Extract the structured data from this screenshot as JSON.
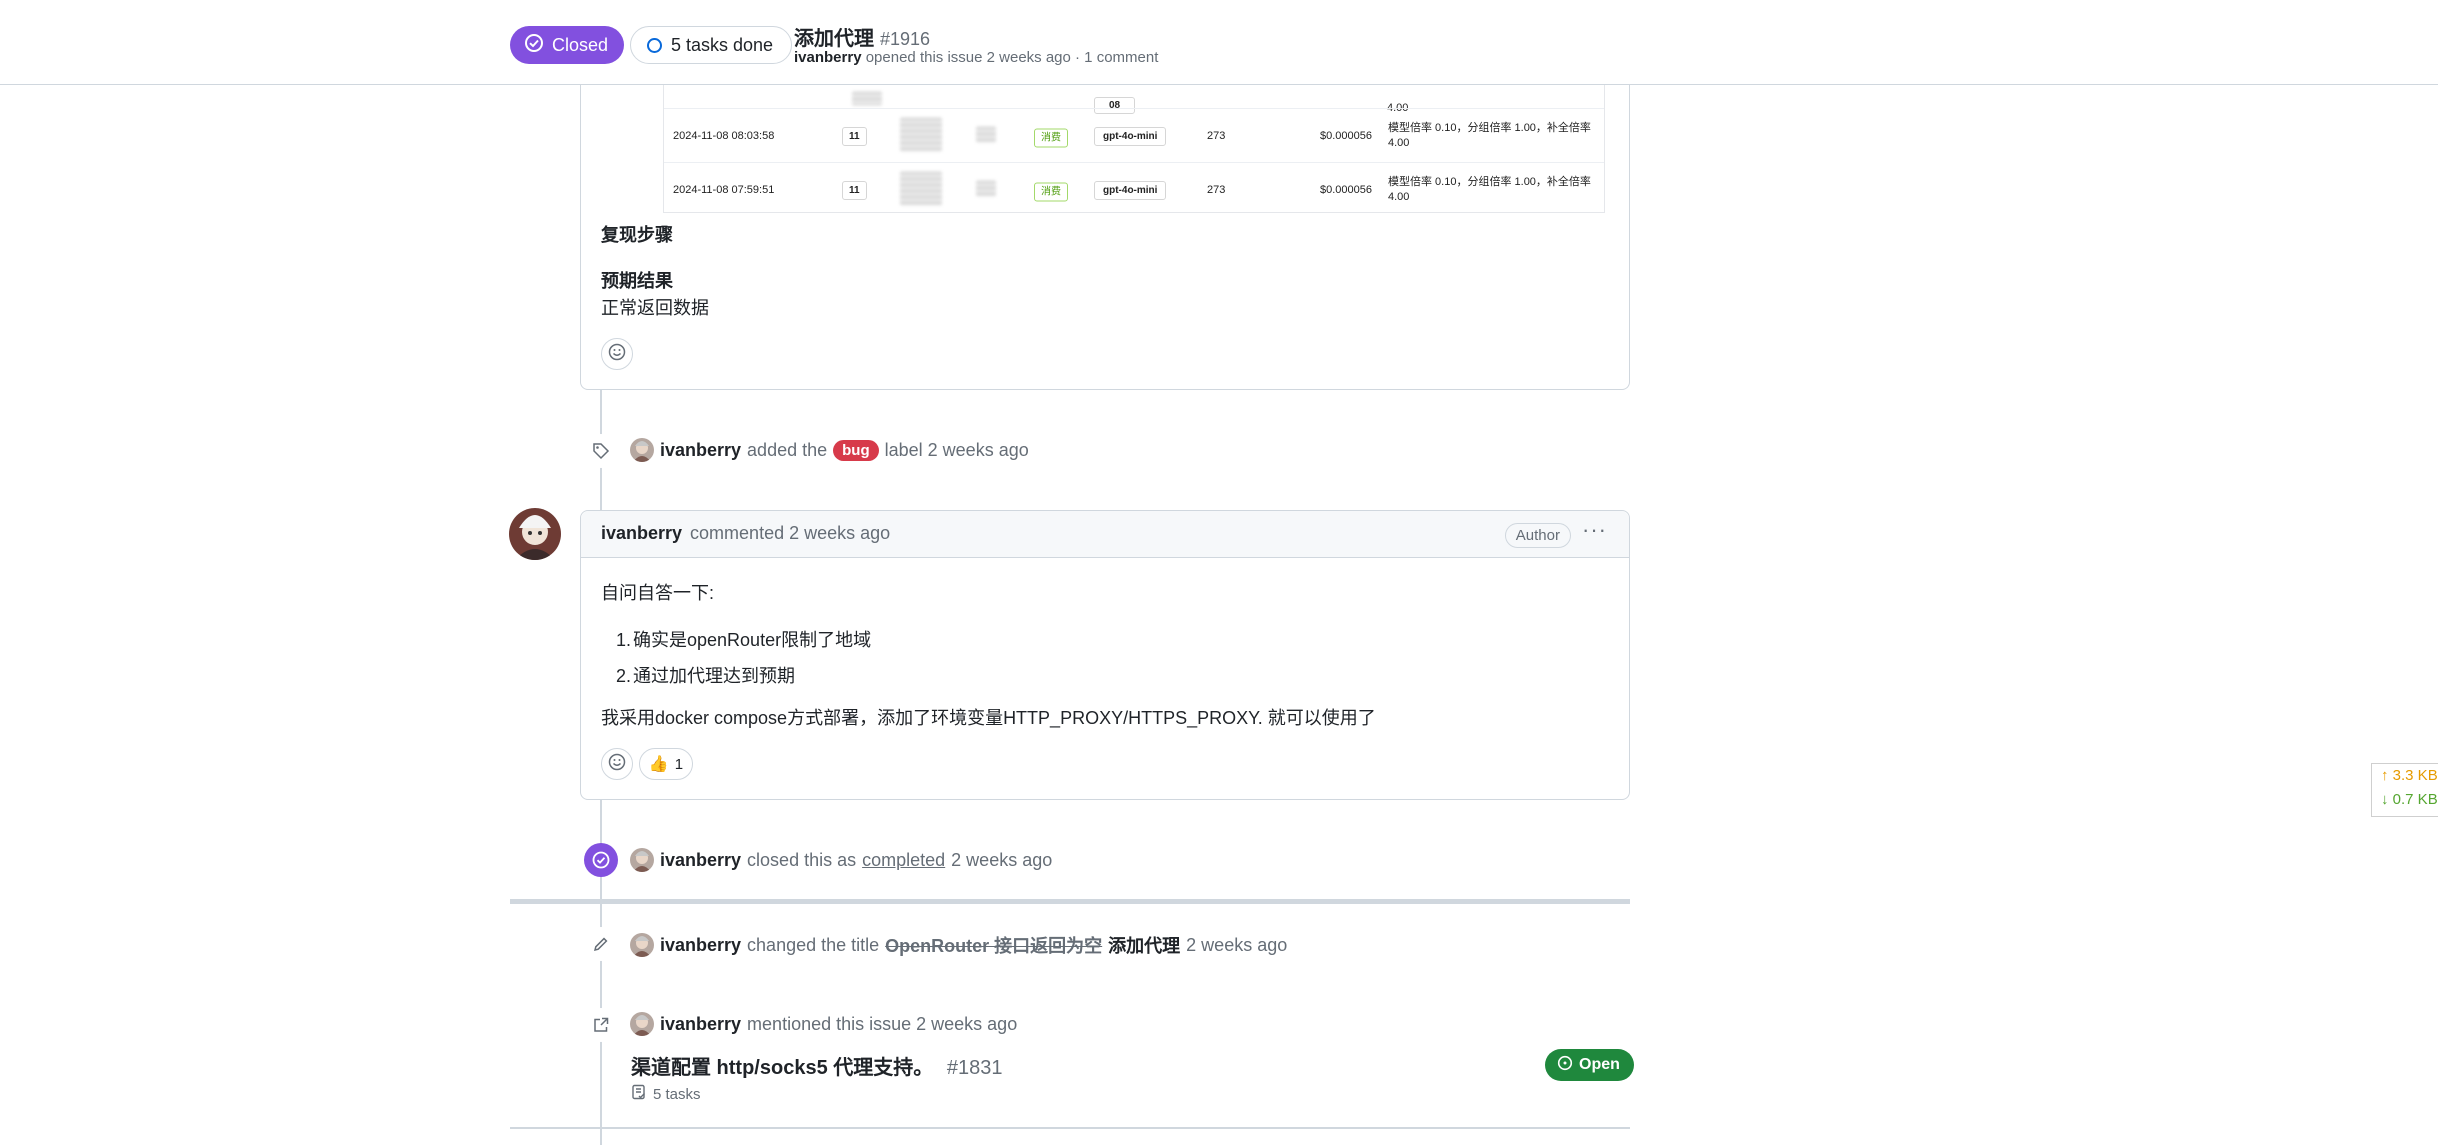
{
  "header": {
    "state_label": "Closed",
    "tasks_label": "5 tasks done",
    "title": "添加代理",
    "number": "#1916",
    "author": "ivanberry",
    "meta_rest": "opened this issue 2 weeks ago · 1 comment"
  },
  "screenshot_table": {
    "partial_top": {
      "cost_rate": "4.00",
      "model_partial": "08"
    },
    "rows": [
      {
        "time": "2024-11-08 08:03:58",
        "id": "11",
        "type": "消费",
        "model": "gpt-4o-mini",
        "tokens": "273",
        "cost": "$0.000056",
        "detail": "模型倍率 0.10，分组倍率 1.00，补全倍率 4.00"
      },
      {
        "time": "2024-11-08 07:59:51",
        "id": "11",
        "type": "消费",
        "model": "gpt-4o-mini",
        "tokens": "273",
        "cost": "$0.000056",
        "detail": "模型倍率 0.10，分组倍率 1.00，补全倍率 4.00"
      }
    ]
  },
  "issue_body": {
    "repro_heading": "复现步骤",
    "expected_heading": "预期结果",
    "expected_text": "正常返回数据"
  },
  "event_label": {
    "user": "ivanberry",
    "before": "added the",
    "label": "bug",
    "after": "label 2 weeks ago"
  },
  "comment": {
    "author": "ivanberry",
    "meta": "commented 2 weeks ago",
    "author_badge": "Author",
    "intro": "自问自答一下:",
    "list": [
      "确实是openRouter限制了地域",
      "通过加代理达到预期"
    ],
    "conclusion": "我采用docker compose方式部署，添加了环境变量HTTP_PROXY/HTTPS_PROXY. 就可以使用了",
    "thumbs_count": "1"
  },
  "event_closed": {
    "user": "ivanberry",
    "before": "closed this as",
    "link": "completed",
    "after": "2 weeks ago"
  },
  "event_title": {
    "user": "ivanberry",
    "before": "changed the title",
    "old_title": "OpenRouter 接口返回为空",
    "new_title": "添加代理",
    "after": "2 weeks ago"
  },
  "event_mention": {
    "user": "ivanberry",
    "text": "mentioned this issue 2 weeks ago",
    "ref_title": "渠道配置 http/socks5 代理支持。",
    "ref_number": "#1831",
    "ref_tasks": "5 tasks",
    "ref_state": "Open"
  },
  "speed_widget": {
    "up": "↑ 3.3 KB",
    "down": "↓ 0.7 KB"
  },
  "colors": {
    "closed_purple": "#8250df",
    "open_green": "#1f883d",
    "bug_red": "#d73a4a",
    "link_blue": "#0969da"
  }
}
